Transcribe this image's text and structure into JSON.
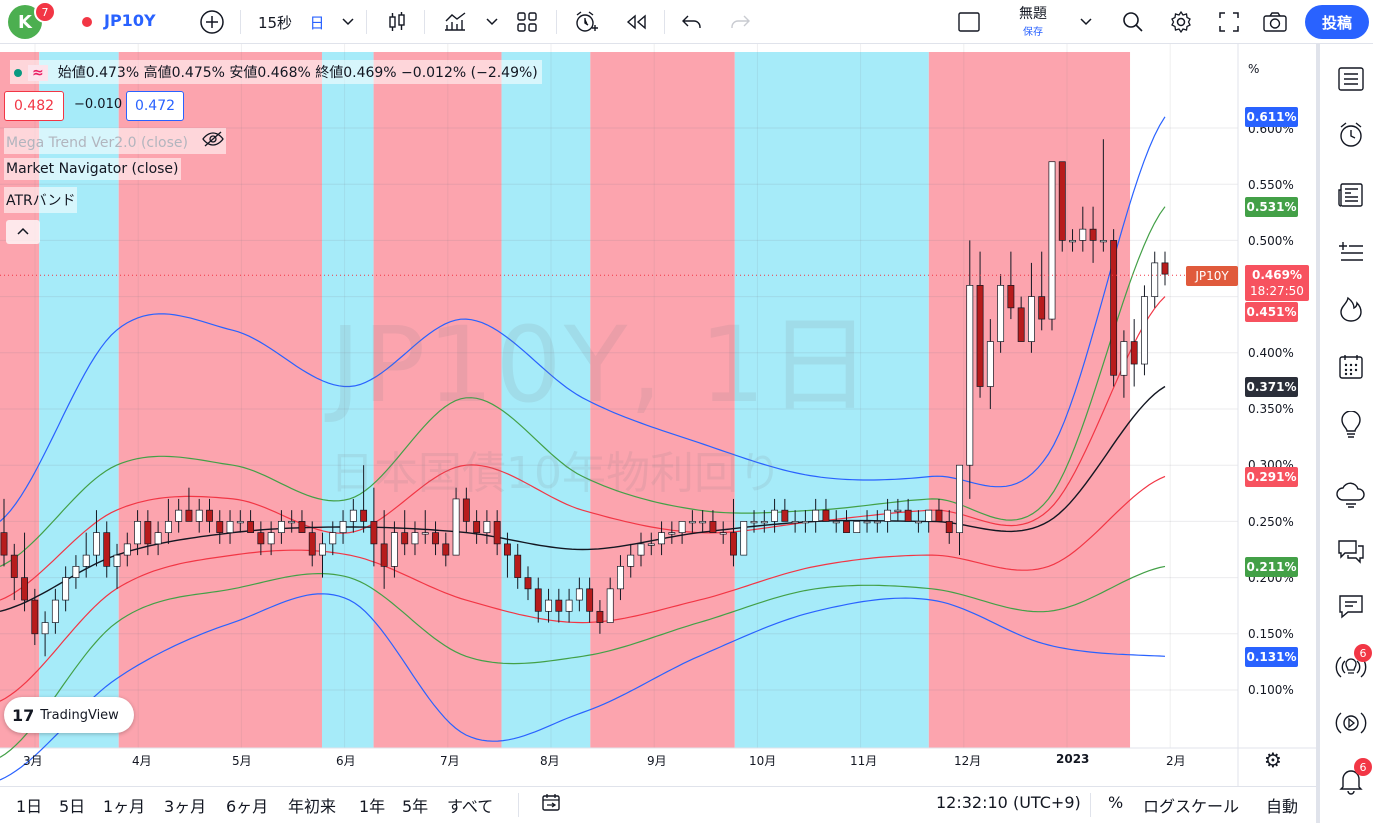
{
  "header": {
    "avatar_letter": "K",
    "avatar_badge": "7",
    "symbol": "JP10Y",
    "interval_seconds": "15秒",
    "interval_day": "日",
    "layout_title": "無題",
    "layout_saved": "保存",
    "post_button": "投稿",
    "icons": [
      "plus-circle-icon",
      "candlestick-icon",
      "indicators-icon",
      "chevron-down-icon",
      "templates-icon",
      "alert-icon",
      "replay-icon",
      "undo-icon",
      "redo-icon",
      "layout-icon",
      "chevron-down-icon",
      "search-icon",
      "settings-icon",
      "fullscreen-icon",
      "camera-icon"
    ]
  },
  "legend": {
    "ohlc_text": "始値0.473%  高値0.475%  安値0.468%  終値0.469%  −0.012% (−2.49%)",
    "bid": "0.482",
    "spread": "−0.010",
    "ask": "0.472",
    "indicators": [
      "Mega Trend Ver2.0 (close)",
      "Market Navigator (close)",
      "ATRバンド"
    ]
  },
  "watermark": {
    "symbol": "JP10Y, 1日",
    "description": "日本国債10年物利回り"
  },
  "price_axis": {
    "unit": "%",
    "ticks": [
      "0.600%",
      "0.550%",
      "0.500%",
      "0.400%",
      "0.350%",
      "0.300%",
      "0.250%",
      "0.200%",
      "0.150%",
      "0.100%"
    ],
    "tags": [
      {
        "text": "0.611%",
        "color": "#2962ff"
      },
      {
        "text": "0.531%",
        "color": "#43a047"
      },
      {
        "text": "0.451%",
        "color": "#f7525f"
      },
      {
        "text": "0.371%",
        "color": "#2a2e39"
      },
      {
        "text": "0.291%",
        "color": "#f7525f"
      },
      {
        "text": "0.211%",
        "color": "#43a047"
      },
      {
        "text": "0.131%",
        "color": "#2962ff"
      }
    ],
    "current_symbol": "JP10Y",
    "current_price": "0.469%",
    "countdown": "18:27:50"
  },
  "time_axis": {
    "ticks": [
      "3月",
      "4月",
      "5月",
      "6月",
      "7月",
      "8月",
      "9月",
      "10月",
      "11月",
      "12月",
      "2023",
      "2月"
    ]
  },
  "bottom_bar": {
    "ranges": [
      "1日",
      "5日",
      "1ヶ月",
      "3ヶ月",
      "6ヶ月",
      "年初来",
      "1年",
      "5年",
      "すべて"
    ],
    "clock": "12:32:10 (UTC+9)",
    "percent": "%",
    "log_scale": "ログスケール",
    "auto": "自動"
  },
  "right_sidebar": {
    "icons": [
      "watchlist-icon",
      "alarm-icon",
      "news-icon",
      "add-list-icon",
      "hot-icon",
      "calendar-icon",
      "idea-icon",
      "chat-cloud-icon",
      "chats-icon",
      "messages-icon",
      "streams-icon",
      "play-icon",
      "notifications-icon"
    ],
    "streams_badge": "6",
    "notifications_badge": "6"
  },
  "branding": {
    "logo_text": "TradingView"
  },
  "chart_data": {
    "type": "candlestick",
    "symbol": "JP10Y",
    "timeframe": "1日",
    "y_unit": "%",
    "ylim": [
      0.05,
      0.66
    ],
    "x_months": [
      "3月",
      "4月",
      "5月",
      "6月",
      "7月",
      "8月",
      "9月",
      "10月",
      "11月",
      "12月",
      "2023",
      "2月"
    ],
    "trend_zones": [
      {
        "start": 0.0,
        "end": 0.38,
        "trend": "down"
      },
      {
        "start": 0.38,
        "end": 1.15,
        "trend": "up"
      },
      {
        "start": 1.15,
        "end": 3.12,
        "trend": "down"
      },
      {
        "start": 3.12,
        "end": 3.62,
        "trend": "up"
      },
      {
        "start": 3.62,
        "end": 4.86,
        "trend": "down"
      },
      {
        "start": 4.86,
        "end": 5.72,
        "trend": "up"
      },
      {
        "start": 5.72,
        "end": 7.12,
        "trend": "down"
      },
      {
        "start": 7.12,
        "end": 9.0,
        "trend": "up"
      },
      {
        "start": 9.0,
        "end": 10.95,
        "trend": "down"
      }
    ],
    "zone_colors": {
      "up": "#a6ebf9",
      "down": "#fca4ae"
    },
    "candles": [
      [
        0.24,
        0.27,
        0.21,
        0.22
      ],
      [
        0.22,
        0.23,
        0.18,
        0.2
      ],
      [
        0.2,
        0.24,
        0.17,
        0.18
      ],
      [
        0.18,
        0.19,
        0.14,
        0.15
      ],
      [
        0.15,
        0.17,
        0.13,
        0.16
      ],
      [
        0.16,
        0.19,
        0.15,
        0.18
      ],
      [
        0.18,
        0.21,
        0.17,
        0.2
      ],
      [
        0.2,
        0.22,
        0.19,
        0.21
      ],
      [
        0.21,
        0.24,
        0.2,
        0.22
      ],
      [
        0.22,
        0.26,
        0.21,
        0.24
      ],
      [
        0.24,
        0.25,
        0.2,
        0.21
      ],
      [
        0.21,
        0.23,
        0.19,
        0.22
      ],
      [
        0.22,
        0.24,
        0.21,
        0.23
      ],
      [
        0.23,
        0.26,
        0.22,
        0.25
      ],
      [
        0.25,
        0.26,
        0.22,
        0.23
      ],
      [
        0.23,
        0.25,
        0.22,
        0.24
      ],
      [
        0.24,
        0.27,
        0.23,
        0.25
      ],
      [
        0.25,
        0.27,
        0.24,
        0.26
      ],
      [
        0.26,
        0.28,
        0.25,
        0.25
      ],
      [
        0.25,
        0.27,
        0.24,
        0.26
      ],
      [
        0.26,
        0.27,
        0.24,
        0.25
      ],
      [
        0.25,
        0.26,
        0.23,
        0.24
      ],
      [
        0.24,
        0.26,
        0.23,
        0.25
      ],
      [
        0.25,
        0.26,
        0.24,
        0.25
      ],
      [
        0.25,
        0.26,
        0.24,
        0.24
      ],
      [
        0.24,
        0.25,
        0.22,
        0.23
      ],
      [
        0.23,
        0.25,
        0.22,
        0.24
      ],
      [
        0.24,
        0.26,
        0.23,
        0.25
      ],
      [
        0.25,
        0.26,
        0.24,
        0.25
      ],
      [
        0.25,
        0.26,
        0.24,
        0.24
      ],
      [
        0.24,
        0.25,
        0.21,
        0.22
      ],
      [
        0.22,
        0.24,
        0.2,
        0.23
      ],
      [
        0.23,
        0.25,
        0.22,
        0.24
      ],
      [
        0.24,
        0.26,
        0.23,
        0.25
      ],
      [
        0.25,
        0.27,
        0.24,
        0.26
      ],
      [
        0.26,
        0.3,
        0.24,
        0.25
      ],
      [
        0.25,
        0.28,
        0.21,
        0.23
      ],
      [
        0.23,
        0.26,
        0.19,
        0.21
      ],
      [
        0.21,
        0.25,
        0.2,
        0.24
      ],
      [
        0.24,
        0.26,
        0.22,
        0.23
      ],
      [
        0.23,
        0.25,
        0.22,
        0.24
      ],
      [
        0.24,
        0.26,
        0.23,
        0.24
      ],
      [
        0.24,
        0.25,
        0.22,
        0.23
      ],
      [
        0.23,
        0.24,
        0.21,
        0.22
      ],
      [
        0.22,
        0.28,
        0.22,
        0.27
      ],
      [
        0.27,
        0.28,
        0.24,
        0.25
      ],
      [
        0.25,
        0.26,
        0.23,
        0.24
      ],
      [
        0.24,
        0.26,
        0.23,
        0.25
      ],
      [
        0.25,
        0.26,
        0.22,
        0.23
      ],
      [
        0.23,
        0.24,
        0.2,
        0.22
      ],
      [
        0.22,
        0.23,
        0.19,
        0.2
      ],
      [
        0.2,
        0.21,
        0.18,
        0.19
      ],
      [
        0.19,
        0.2,
        0.16,
        0.17
      ],
      [
        0.17,
        0.19,
        0.16,
        0.18
      ],
      [
        0.18,
        0.19,
        0.16,
        0.17
      ],
      [
        0.17,
        0.19,
        0.16,
        0.18
      ],
      [
        0.18,
        0.2,
        0.17,
        0.19
      ],
      [
        0.19,
        0.2,
        0.16,
        0.17
      ],
      [
        0.17,
        0.18,
        0.15,
        0.16
      ],
      [
        0.16,
        0.2,
        0.16,
        0.19
      ],
      [
        0.19,
        0.22,
        0.18,
        0.21
      ],
      [
        0.21,
        0.23,
        0.2,
        0.22
      ],
      [
        0.22,
        0.24,
        0.21,
        0.23
      ],
      [
        0.23,
        0.24,
        0.22,
        0.23
      ],
      [
        0.23,
        0.25,
        0.22,
        0.24
      ],
      [
        0.24,
        0.25,
        0.23,
        0.24
      ],
      [
        0.24,
        0.25,
        0.23,
        0.25
      ],
      [
        0.25,
        0.26,
        0.24,
        0.25
      ],
      [
        0.25,
        0.26,
        0.24,
        0.25
      ],
      [
        0.25,
        0.26,
        0.24,
        0.24
      ],
      [
        0.24,
        0.25,
        0.23,
        0.24
      ],
      [
        0.24,
        0.27,
        0.21,
        0.22
      ],
      [
        0.22,
        0.25,
        0.22,
        0.25
      ],
      [
        0.25,
        0.26,
        0.24,
        0.25
      ],
      [
        0.25,
        0.26,
        0.24,
        0.25
      ],
      [
        0.25,
        0.27,
        0.24,
        0.26
      ],
      [
        0.26,
        0.27,
        0.25,
        0.25
      ],
      [
        0.25,
        0.26,
        0.24,
        0.25
      ],
      [
        0.25,
        0.26,
        0.24,
        0.25
      ],
      [
        0.25,
        0.27,
        0.24,
        0.26
      ],
      [
        0.26,
        0.27,
        0.25,
        0.25
      ],
      [
        0.25,
        0.26,
        0.24,
        0.25
      ],
      [
        0.25,
        0.26,
        0.24,
        0.24
      ],
      [
        0.24,
        0.25,
        0.24,
        0.25
      ],
      [
        0.25,
        0.26,
        0.24,
        0.25
      ],
      [
        0.25,
        0.26,
        0.24,
        0.25
      ],
      [
        0.25,
        0.27,
        0.24,
        0.26
      ],
      [
        0.26,
        0.27,
        0.25,
        0.26
      ],
      [
        0.26,
        0.27,
        0.25,
        0.25
      ],
      [
        0.25,
        0.26,
        0.24,
        0.25
      ],
      [
        0.25,
        0.26,
        0.24,
        0.26
      ],
      [
        0.26,
        0.27,
        0.25,
        0.25
      ],
      [
        0.25,
        0.26,
        0.23,
        0.24
      ],
      [
        0.24,
        0.25,
        0.22,
        0.3
      ],
      [
        0.3,
        0.5,
        0.27,
        0.46
      ],
      [
        0.46,
        0.49,
        0.36,
        0.37
      ],
      [
        0.37,
        0.43,
        0.35,
        0.41
      ],
      [
        0.41,
        0.47,
        0.4,
        0.46
      ],
      [
        0.46,
        0.49,
        0.43,
        0.44
      ],
      [
        0.44,
        0.45,
        0.41,
        0.41
      ],
      [
        0.41,
        0.48,
        0.4,
        0.45
      ],
      [
        0.45,
        0.49,
        0.42,
        0.43
      ],
      [
        0.43,
        0.57,
        0.42,
        0.57
      ],
      [
        0.57,
        0.57,
        0.49,
        0.5
      ],
      [
        0.5,
        0.51,
        0.49,
        0.5
      ],
      [
        0.5,
        0.53,
        0.49,
        0.51
      ],
      [
        0.51,
        0.53,
        0.48,
        0.5
      ],
      [
        0.5,
        0.59,
        0.49,
        0.5
      ],
      [
        0.5,
        0.51,
        0.37,
        0.38
      ],
      [
        0.38,
        0.42,
        0.36,
        0.41
      ],
      [
        0.41,
        0.43,
        0.37,
        0.39
      ],
      [
        0.39,
        0.46,
        0.38,
        0.45
      ],
      [
        0.45,
        0.49,
        0.44,
        0.48
      ],
      [
        0.48,
        0.49,
        0.46,
        0.47
      ]
    ],
    "moving_average": [
      0.17,
      0.22,
      0.24,
      0.245,
      0.24,
      0.225,
      0.24,
      0.25,
      0.25,
      0.25,
      0.37
    ],
    "bands": {
      "upper_blue": [
        0.25,
        0.42,
        0.42,
        0.37,
        0.43,
        0.36,
        0.32,
        0.29,
        0.29,
        0.31,
        0.61
      ],
      "upper_green": [
        0.21,
        0.3,
        0.3,
        0.27,
        0.36,
        0.29,
        0.26,
        0.26,
        0.27,
        0.27,
        0.53
      ],
      "upper_red": [
        0.18,
        0.26,
        0.27,
        0.24,
        0.3,
        0.26,
        0.24,
        0.25,
        0.26,
        0.26,
        0.45
      ],
      "lower_red": [
        0.09,
        0.19,
        0.22,
        0.22,
        0.18,
        0.16,
        0.18,
        0.21,
        0.22,
        0.21,
        0.29
      ],
      "lower_green": [
        0.04,
        0.16,
        0.19,
        0.2,
        0.13,
        0.13,
        0.16,
        0.19,
        0.19,
        0.17,
        0.21
      ],
      "lower_blue": [
        0.02,
        0.11,
        0.16,
        0.18,
        0.06,
        0.08,
        0.13,
        0.17,
        0.18,
        0.14,
        0.13
      ]
    }
  }
}
